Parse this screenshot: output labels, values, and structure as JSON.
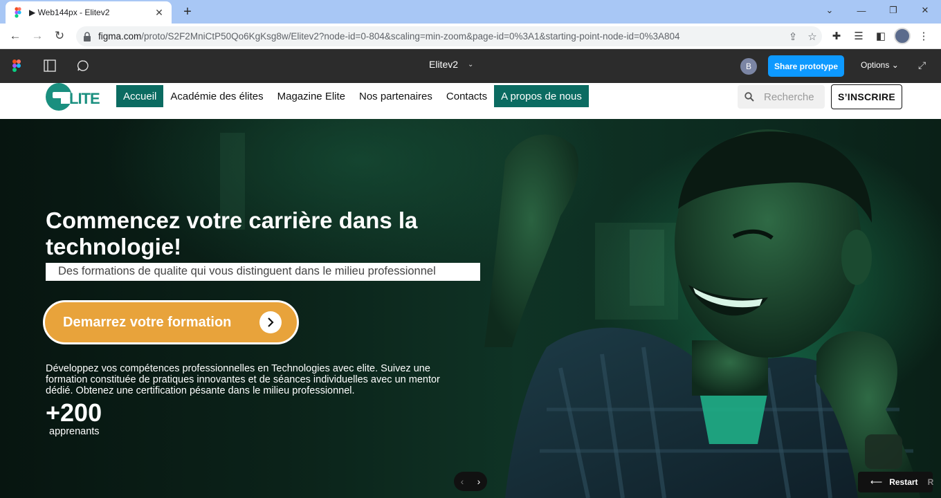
{
  "browser": {
    "tab_title": "▶ Web144px - Elitev2",
    "tab_close": "✕",
    "new_tab": "+",
    "url_main": "figma.com",
    "url_rest": "/proto/S2F2MniCtP50Qo6KgKsg8w/Elitev2?node-id=0-804&scaling=min-zoom&page-id=0%3A1&starting-point-node-id=0%3A804"
  },
  "figma": {
    "file_title": "Elitev2",
    "avatar_initial": "B",
    "share_label": "Share prototype",
    "options_label": "Options ⌄",
    "restart_label": "Restart",
    "restart_key": "R"
  },
  "site": {
    "nav": [
      {
        "label": "Accueil",
        "active": true
      },
      {
        "label": "Académie des élites",
        "active": false
      },
      {
        "label": "Magazine Elite",
        "active": false
      },
      {
        "label": "Nos partenaires",
        "active": false
      },
      {
        "label": "Contacts",
        "active": false
      },
      {
        "label": "A propos de nous",
        "active": true
      }
    ],
    "logo_text": "LITE",
    "search_placeholder": "Recherche",
    "signup_label": "S’INSCRIRE"
  },
  "hero": {
    "title": "Commencez votre carrière dans la technologie!",
    "subtitle": "Des formations de qualite qui vous distinguent dans le milieu professionnel",
    "cta_label": "Demarrez votre formation",
    "description": "Développez vos compétences professionnelles en Technologies avec elite. Suivez une formation constituée de pratiques innovantes et de séances individuelles avec un mentor dédié. Obtenez une certification pésante dans le milieu professionnel.",
    "stat_value": "+200",
    "stat_label": "apprenants"
  },
  "colors": {
    "brand_teal": "#1a8f7f",
    "nav_active": "#0b6b61",
    "cta_orange": "#e8a33b",
    "figma_blue": "#0d99ff"
  }
}
